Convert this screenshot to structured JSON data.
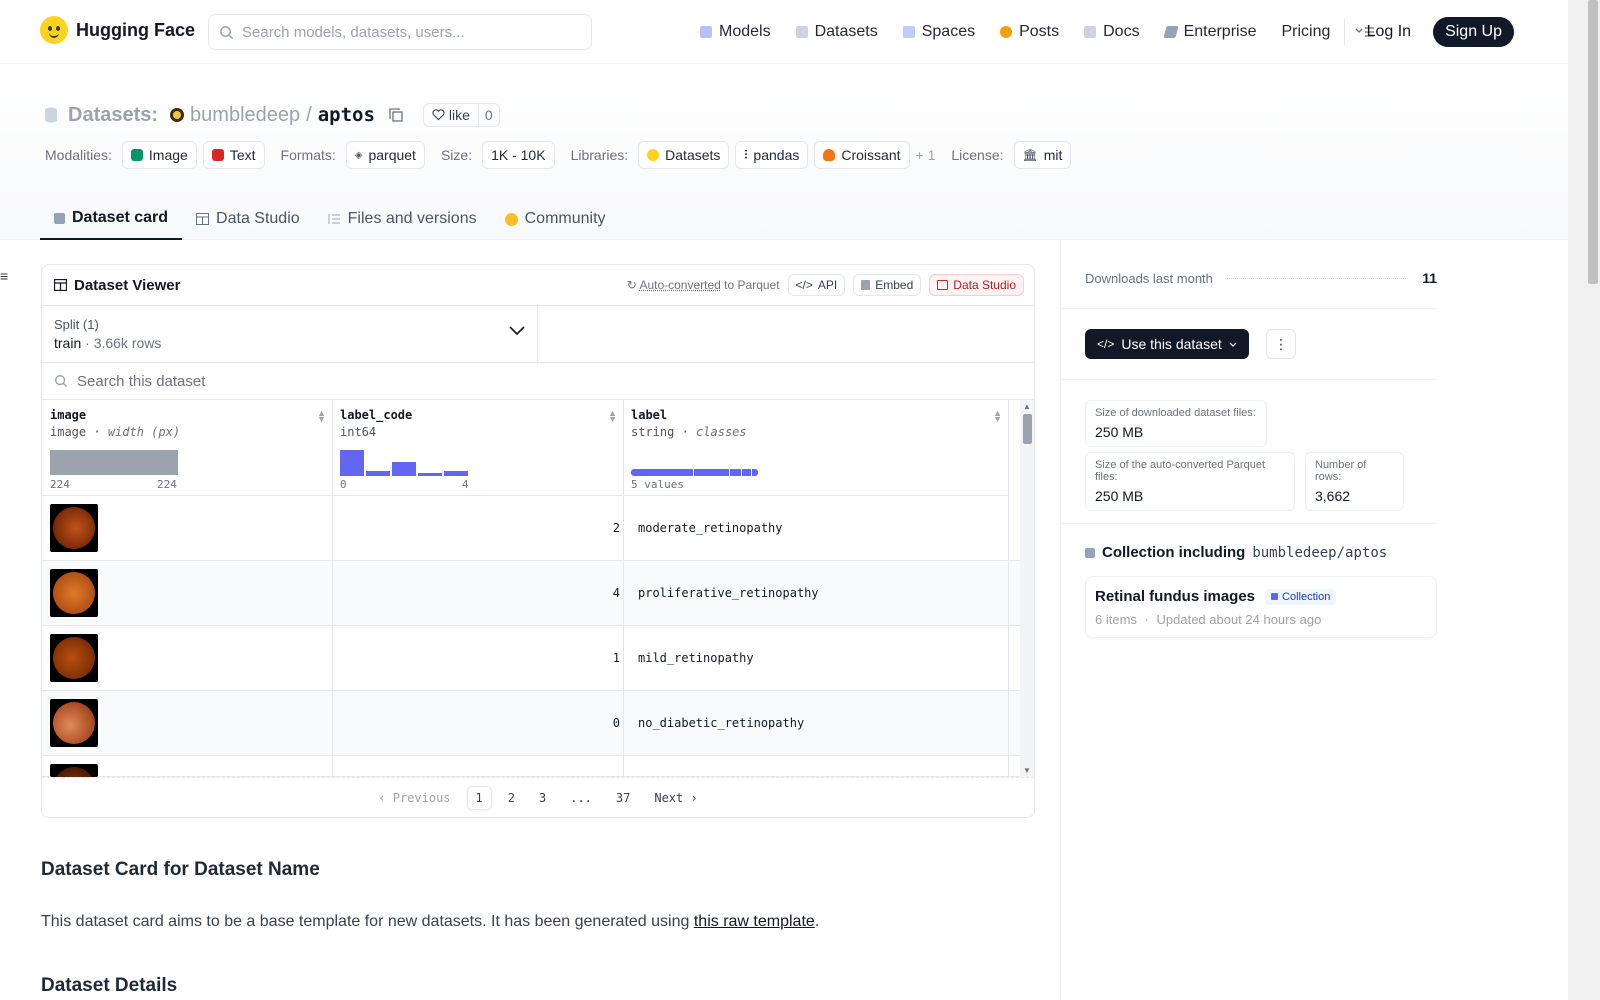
{
  "nav": {
    "brand": "Hugging Face",
    "search_placeholder": "Search models, datasets, users...",
    "links": [
      "Models",
      "Datasets",
      "Spaces",
      "Posts",
      "Docs",
      "Enterprise",
      "Pricing"
    ],
    "login": "Log In",
    "signup": "Sign Up"
  },
  "repo": {
    "section": "Datasets:",
    "owner": "bumbledeep",
    "separator": "/",
    "name": "aptos",
    "like_label": "like",
    "like_count": "0"
  },
  "tags": {
    "modalities_label": "Modalities:",
    "modalities": [
      "Image",
      "Text"
    ],
    "formats_label": "Formats:",
    "format": "parquet",
    "size_label": "Size:",
    "size": "1K - 10K",
    "libraries_label": "Libraries:",
    "libraries": [
      "Datasets",
      "pandas",
      "Croissant"
    ],
    "more": "+ 1",
    "license_label": "License:",
    "license": "mit"
  },
  "tabs": [
    "Dataset card",
    "Data Studio",
    "Files and versions",
    "Community"
  ],
  "viewer": {
    "title": "Dataset Viewer",
    "auto_converted": "Auto-converted",
    "to_parquet": "to Parquet",
    "api": "API",
    "embed": "Embed",
    "data_studio": "Data Studio",
    "split_label": "Split (1)",
    "split_name": "train",
    "split_dot": "·",
    "split_rows": "3.66k rows",
    "search_placeholder": "Search this dataset",
    "columns": [
      {
        "name": "image",
        "type": "image",
        "stat": "width (px)",
        "min": "224",
        "max": "224"
      },
      {
        "name": "label_code",
        "type": "int64",
        "stat": "",
        "min": "0",
        "max": "4"
      },
      {
        "name": "label",
        "type": "string",
        "stat": "classes",
        "summary": "5 values"
      }
    ],
    "rows": [
      {
        "label_code": "2",
        "label": "moderate_retinopathy",
        "tint": "#8a3a0e"
      },
      {
        "label_code": "4",
        "label": "proliferative_retinopathy",
        "tint": "#c8611c"
      },
      {
        "label_code": "1",
        "label": "mild_retinopathy",
        "tint": "#9c3f0a"
      },
      {
        "label_code": "0",
        "label": "no_diabetic_retinopathy",
        "tint": "#b8522e"
      }
    ],
    "pager": {
      "prev": "Previous",
      "pages": [
        "1",
        "2",
        "3",
        "...",
        "37"
      ],
      "next": "Next"
    }
  },
  "card": {
    "heading": "Dataset Card for Dataset Name",
    "text_before": "This dataset card aims to be a base template for new datasets. It has been generated using ",
    "link": "this raw template",
    "text_after": ".",
    "details_heading": "Dataset Details"
  },
  "sidebar": {
    "downloads_label": "Downloads last month",
    "downloads": "11",
    "use_button": "Use this dataset",
    "size_dl_label": "Size of downloaded dataset files:",
    "size_dl": "250 MB",
    "size_pq_label": "Size of the auto-converted Parquet files:",
    "size_pq": "250 MB",
    "rows_label": "Number of rows:",
    "rows": "3,662",
    "collection_title": "Collection including",
    "collection_repo": "bumbledeep/aptos",
    "collection_name": "Retinal fundus images",
    "collection_badge": "Collection",
    "collection_items": "6 items",
    "collection_dot": "·",
    "collection_updated": "Updated about 24 hours ago"
  },
  "colors": {
    "accent_dark": "#111827",
    "histogram": "#6366f1",
    "brand_yellow": "#ffd21e"
  }
}
